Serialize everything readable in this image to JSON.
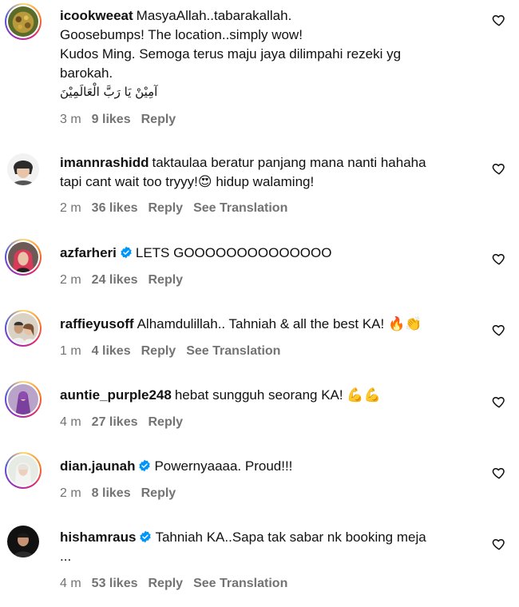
{
  "comments": [
    {
      "username": "icookweeat",
      "verified": false,
      "lines": [
        "MasyaAllah..tabarakallah.",
        "Goosebumps! The location..simply wow!",
        "Kudos Ming. Semoga terus maju jaya dilimpahi rezeki yg",
        "barokah."
      ],
      "arabic": "آمِيْنْ يَا رَبَّ الْعَالَمِيْنَ",
      "time": "3 m",
      "likes": "9 likes",
      "reply": "Reply",
      "see_translation": ""
    },
    {
      "username": "imannrashidd",
      "verified": false,
      "lines": [
        "taktaulaa beratur panjang mana nanti hahaha",
        "tapi cant wait too tryyy!😍 hidup walaming!"
      ],
      "time": "2 m",
      "likes": "36 likes",
      "reply": "Reply",
      "see_translation": "See Translation"
    },
    {
      "username": "azfarheri",
      "verified": true,
      "lines": [
        "LETS GOOOOOOOOOOOOOO"
      ],
      "time": "2 m",
      "likes": "24 likes",
      "reply": "Reply",
      "see_translation": ""
    },
    {
      "username": "raffieyusoff",
      "verified": false,
      "lines": [
        "Alhamdulillah.. Tahniah & all the best KA! 🔥👏"
      ],
      "time": "1 m",
      "likes": "4 likes",
      "reply": "Reply",
      "see_translation": "See Translation"
    },
    {
      "username": "auntie_purple248",
      "verified": false,
      "lines": [
        "hebat sungguh seorang KA! 💪💪"
      ],
      "time": "4 m",
      "likes": "27 likes",
      "reply": "Reply",
      "see_translation": ""
    },
    {
      "username": "dian.jaunah",
      "verified": true,
      "lines": [
        "Powernyaaaa. Proud!!!"
      ],
      "time": "2 m",
      "likes": "8 likes",
      "reply": "Reply",
      "see_translation": ""
    },
    {
      "username": "hishamraus",
      "verified": true,
      "lines": [
        "Tahniah KA..Sapa tak sabar nk booking meja",
        "..."
      ],
      "time": "4 m",
      "likes": "53 likes",
      "reply": "Reply",
      "see_translation": "See Translation"
    }
  ],
  "icons": {
    "like": "heart-outline-icon",
    "verified": "verified-badge-icon"
  },
  "colors": {
    "verified": "#0095f6",
    "meta": "#737373",
    "ring": "#d62976"
  }
}
